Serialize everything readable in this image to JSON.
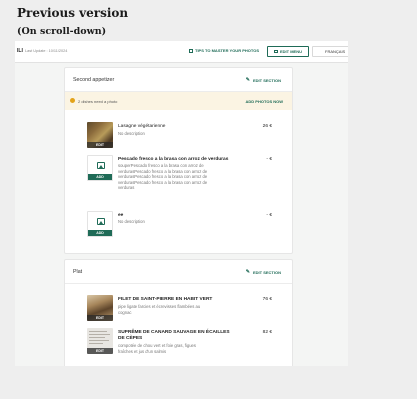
{
  "page": {
    "heading": "Previous version",
    "subheading": "(On scroll-down)"
  },
  "topbar": {
    "logo": "ILI",
    "last_update": "Last Update : 10/11/2024",
    "tips_label": "TIPS TO MASTER YOUR PHOTOS",
    "edit_menu_label": "EDIT MENU",
    "language": "FRANÇAIS"
  },
  "sections": [
    {
      "title": "Second appetizer",
      "edit_label": "EDIT SECTION",
      "warning": "2 dishes need a photo",
      "warning_action": "ADD PHOTOS NOW",
      "items": [
        {
          "name": "Lasagne végétarienne",
          "description": "No description",
          "price": "26 €",
          "button": "EDIT"
        },
        {
          "name": "Pescado fresco a la brasa con arroz de verduras",
          "description_lines": [
            "souperPescado fresco a la brasa con arroz de",
            "verdurasPescado fresco a la brasa con arroz de",
            "verdurasPescado fresco a la brasa con arroz de",
            "verdurasPescado fresco a la brasa con arroz de",
            "verduras"
          ],
          "price": "- €",
          "button": "ADD"
        },
        {
          "name": "ee",
          "description": "No description",
          "price": "- €",
          "button": "ADD"
        }
      ]
    },
    {
      "title": "Plat",
      "edit_label": "EDIT SECTION",
      "items": [
        {
          "name": "FILET DE SAINT-PIERRE EN HABIT VERT",
          "description_lines": [
            "pipe ligate farcies et écrevisses flambées au",
            "cognac"
          ],
          "price": "76 €",
          "button": "EDIT"
        },
        {
          "name_lines": [
            "SUPRÊME DE CANARD SAUVAGE EN ÉCAILLES",
            "DE CÈPES"
          ],
          "description_lines": [
            "compotée de chou vert et foie gras, figues",
            "fraîches et jus d'un salmis"
          ],
          "price": "82 €",
          "button": "EDIT"
        }
      ]
    }
  ],
  "colors": {
    "accent": "#1f6b57",
    "warning_bg": "#fbf4e3",
    "warning_dot": "#e3a31a"
  }
}
